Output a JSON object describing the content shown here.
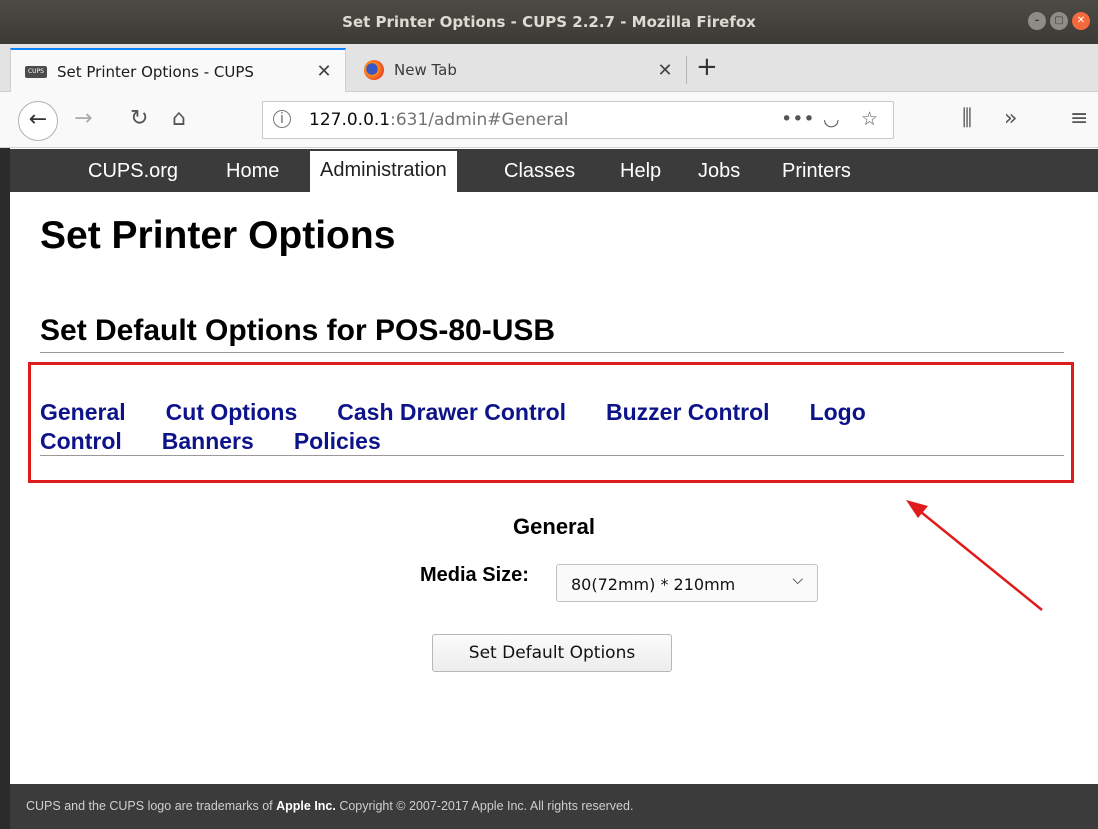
{
  "window": {
    "title": "Set Printer Options - CUPS 2.2.7 - Mozilla Firefox"
  },
  "tabs": [
    {
      "label": "Set Printer Options - CUPS",
      "favicon": "CUPS"
    },
    {
      "label": "New Tab"
    }
  ],
  "urlbar": {
    "host": "127.0.0.1",
    "path": ":631/admin#General"
  },
  "cups_nav": [
    "CUPS.org",
    "Home",
    "Administration",
    "Classes",
    "Help",
    "Jobs",
    "Printers"
  ],
  "page": {
    "title": "Set Printer Options",
    "subtitle": "Set Default Options for POS-80-USB",
    "option_links": [
      "General",
      "Cut Options",
      "Cash Drawer Control",
      "Buzzer Control",
      "Logo Control",
      "Banners",
      "Policies"
    ],
    "section_title": "General",
    "media_label": "Media Size:",
    "media_value": "80(72mm) * 210mm",
    "submit_label": "Set Default Options"
  },
  "footer": {
    "pre": "CUPS and the CUPS logo are trademarks of ",
    "apple": "Apple Inc.",
    "post": " Copyright © 2007-2017 Apple Inc. All rights reserved."
  },
  "colors": {
    "link": "#0d148a",
    "highlight": "#e01b1b",
    "navbar": "#3b3b3b"
  },
  "icons": [
    "back-icon",
    "forward-icon",
    "reload-icon",
    "home-icon",
    "page-actions-icon",
    "pocket-icon",
    "bookmark-star-icon",
    "library-icon",
    "overflow-icon",
    "menu-icon"
  ]
}
